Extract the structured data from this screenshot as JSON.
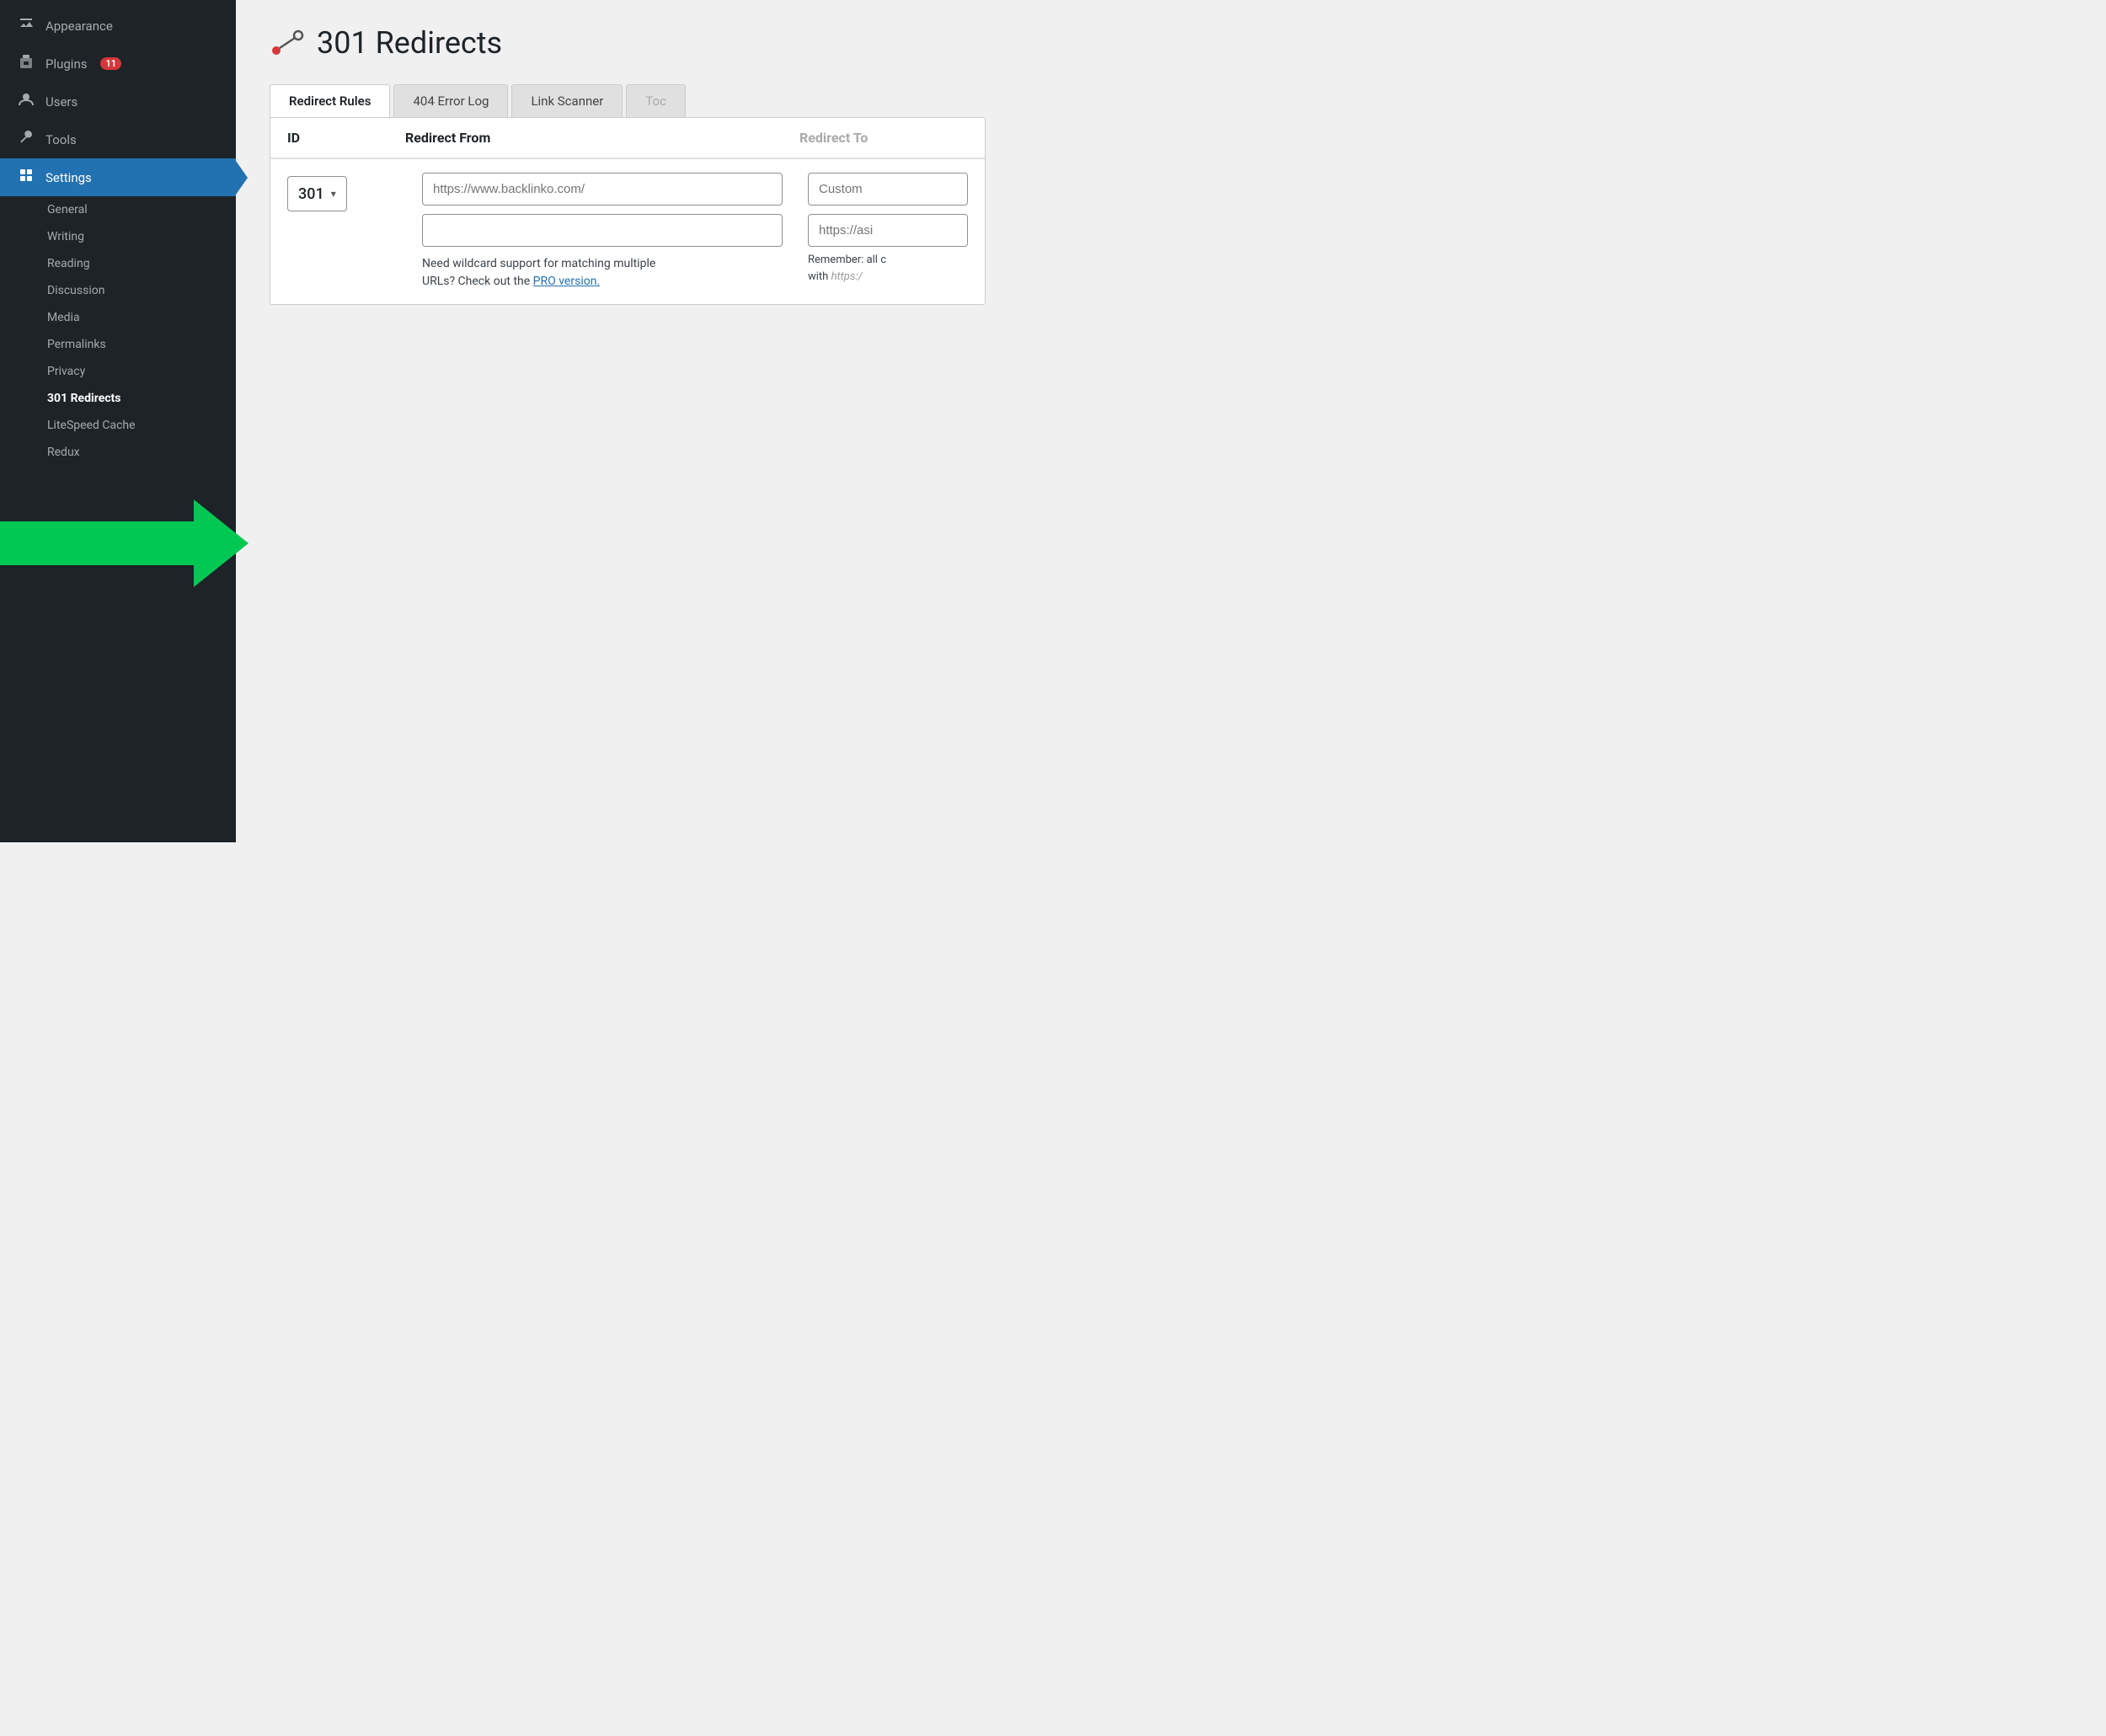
{
  "sidebar": {
    "items": [
      {
        "id": "appearance",
        "label": "Appearance",
        "icon": "🔨",
        "active": false
      },
      {
        "id": "plugins",
        "label": "Plugins",
        "icon": "🔌",
        "badge": "11",
        "active": false
      },
      {
        "id": "users",
        "label": "Users",
        "icon": "👤",
        "active": false
      },
      {
        "id": "tools",
        "label": "Tools",
        "icon": "🔧",
        "active": false
      },
      {
        "id": "settings",
        "label": "Settings",
        "icon": "⚙",
        "active": true
      }
    ],
    "subitems": [
      {
        "id": "general",
        "label": "General",
        "bold": false
      },
      {
        "id": "writing",
        "label": "Writing",
        "bold": false
      },
      {
        "id": "reading",
        "label": "Reading",
        "bold": false
      },
      {
        "id": "discussion",
        "label": "Discussion",
        "bold": false
      },
      {
        "id": "media",
        "label": "Media",
        "bold": false
      },
      {
        "id": "permalinks",
        "label": "Permalinks",
        "bold": false
      },
      {
        "id": "privacy",
        "label": "Privacy",
        "bold": false
      },
      {
        "id": "redirects",
        "label": "301 Redirects",
        "bold": true
      },
      {
        "id": "litespeed",
        "label": "LiteSpeed Cache",
        "bold": false
      },
      {
        "id": "redux",
        "label": "Redux",
        "bold": false
      }
    ]
  },
  "page": {
    "title": "301 Redirects",
    "icon_alt": "301 redirects plugin icon"
  },
  "tabs": [
    {
      "id": "redirect-rules",
      "label": "Redirect Rules",
      "active": true
    },
    {
      "id": "404-error-log",
      "label": "404 Error Log",
      "active": false
    },
    {
      "id": "link-scanner",
      "label": "Link Scanner",
      "active": false
    },
    {
      "id": "toc",
      "label": "Toc",
      "active": false,
      "faded": true
    }
  ],
  "table": {
    "headers": [
      {
        "id": "id",
        "label": "ID"
      },
      {
        "id": "redirect-from",
        "label": "Redirect From"
      },
      {
        "id": "redirect-to",
        "label": "Redirect To",
        "faded": true
      }
    ],
    "form": {
      "id_value": "301",
      "url_placeholder": "https://www.backlinko.com/",
      "secondary_input_placeholder": "",
      "wildcard_text_part1": "Need wildcard support for matching multiple",
      "wildcard_text_part2": "URLs? Check out the",
      "pro_link_text": "PRO version.",
      "custom_placeholder": "Custom",
      "https_placeholder": "https://asi",
      "remember_text_part1": "Remember: all c",
      "remember_text_part2": "with",
      "https_inline_text": "https:/"
    }
  }
}
